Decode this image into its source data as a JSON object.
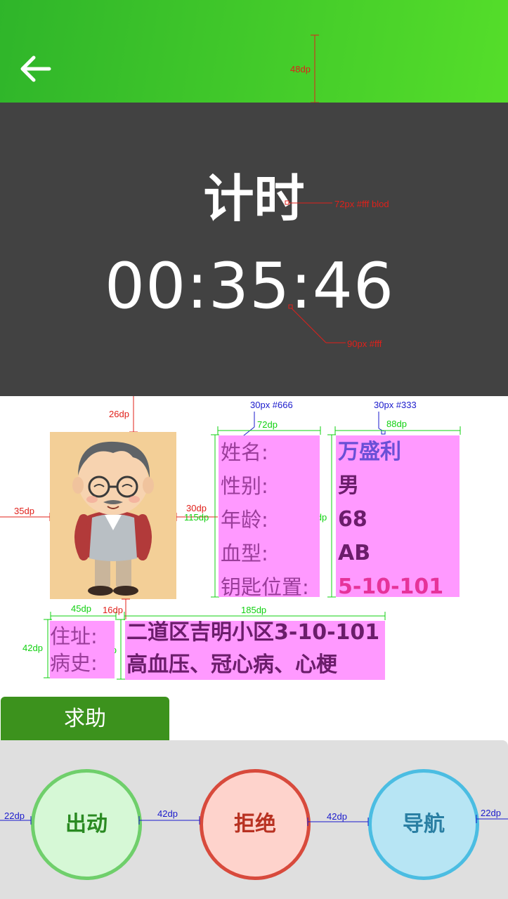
{
  "header": {
    "back_icon": "arrow-left-icon",
    "height_note": "48dp"
  },
  "timer": {
    "title": "计时",
    "value": "00:35:46",
    "title_note": "72px #fff blod",
    "value_note": "90px #fff"
  },
  "patient": {
    "labels": [
      "姓名:",
      "性别:",
      "年龄:",
      "血型:",
      "钥匙位置:"
    ],
    "values": [
      "万盛利",
      "男",
      "68",
      "AB",
      "5-10-101"
    ],
    "address_label": "住址:",
    "history_label": "病史:",
    "address_value": "二道区吉明小区3-10-101",
    "history_value": "高血压、冠心病、心梗"
  },
  "annotations": {
    "top_gap": "26dp",
    "label_style": "30px #666",
    "value_style": "30px #333",
    "label_width": "72dp",
    "value_width": "88dp",
    "left_gap": "35dp",
    "avatar_gap": "30dp",
    "box_height_left": "115dp",
    "box_height_right": "116dp",
    "addr_label_width": "45dp",
    "addr_gap": "16dp",
    "addr_value_width": "185dp",
    "addr_height_left": "42dp",
    "addr_height_right": "42dp",
    "btn_margin_left": "22dp",
    "btn_gap_1": "42dp",
    "btn_gap_2": "42dp",
    "btn_margin_right": "22dp"
  },
  "help_tab": {
    "label": "求助"
  },
  "actions": {
    "dispatch": "出动",
    "reject": "拒绝",
    "navigate": "导航"
  },
  "colors": {
    "header_start": "#2fb52a",
    "header_end": "#55de2a",
    "timer_bg": "#424242",
    "help_tab": "#3c921d",
    "dispatch": "#6fcf6b",
    "reject": "#d84a3c",
    "navigate": "#4bbde2",
    "key_location": "#e6339a"
  }
}
